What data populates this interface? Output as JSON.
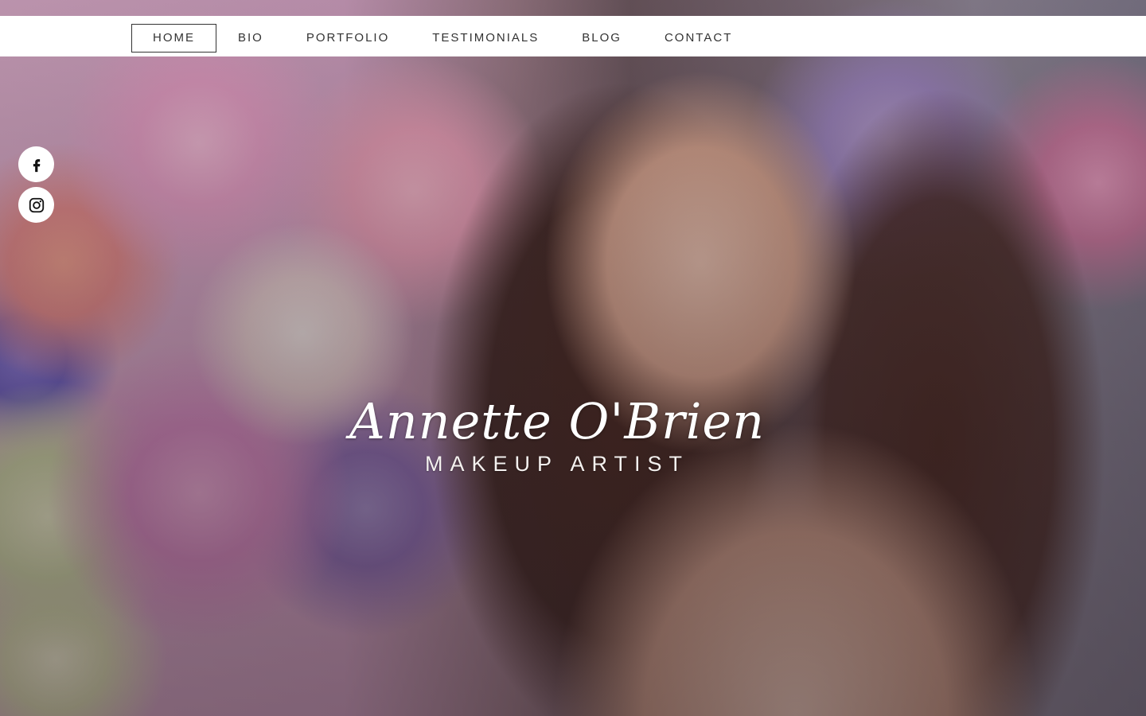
{
  "nav": {
    "items": [
      {
        "label": "HOME",
        "active": true
      },
      {
        "label": "BIO"
      },
      {
        "label": "PORTFOLIO"
      },
      {
        "label": "TESTIMONIALS"
      },
      {
        "label": "BLOG"
      },
      {
        "label": "CONTACT"
      }
    ]
  },
  "social": {
    "icons": [
      "facebook-icon",
      "instagram-icon"
    ]
  },
  "hero": {
    "name": "Annette O'Brien",
    "tagline": "MAKEUP ARTIST"
  },
  "colors": {
    "nav_background": "#ffffff",
    "nav_text": "#333333",
    "hero_text": "#ffffff"
  }
}
